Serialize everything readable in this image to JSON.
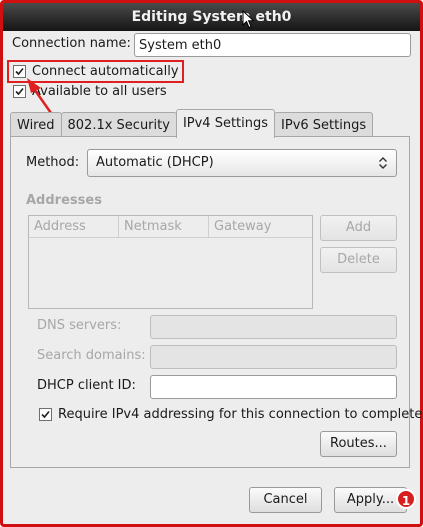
{
  "window": {
    "title": "Editing System eth0"
  },
  "connection": {
    "name_label": "Connection name:",
    "name_value": "System eth0"
  },
  "options": {
    "connect_automatically": "Connect automatically",
    "available_to_all_users": "Available to all users",
    "connect_automatically_checked": true,
    "available_to_all_users_checked": true
  },
  "tabs": [
    {
      "label": "Wired",
      "active": false
    },
    {
      "label": "802.1x Security",
      "active": false
    },
    {
      "label": "IPv4 Settings",
      "active": true
    },
    {
      "label": "IPv6 Settings",
      "active": false
    }
  ],
  "ipv4": {
    "method_label": "Method:",
    "method_value": "Automatic (DHCP)",
    "addresses_heading": "Addresses",
    "columns": [
      "Address",
      "Netmask",
      "Gateway"
    ],
    "add_label": "Add",
    "delete_label": "Delete",
    "dns_label": "DNS servers:",
    "search_label": "Search domains:",
    "dhcp_label": "DHCP client ID:",
    "require_label": "Require IPv4 addressing for this connection to complete",
    "require_checked": true,
    "routes_label": "Routes..."
  },
  "footer": {
    "cancel_label": "Cancel",
    "apply_label": "Apply...",
    "apply_badge": "1"
  },
  "annotation_color": "#e02020"
}
